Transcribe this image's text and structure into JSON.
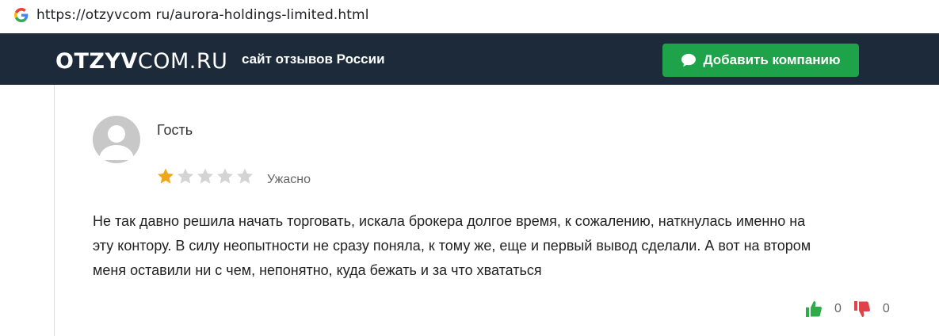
{
  "browser": {
    "url": "https://otzyvcom ru/aurora-holdings-limited.html"
  },
  "header": {
    "logo_bold": "OTZYV",
    "logo_light": "COM.RU",
    "tagline": "сайт отзывов России",
    "add_button_label": "Добавить компанию"
  },
  "review": {
    "author": "Гость",
    "rating": 1,
    "rating_max": 5,
    "rating_label": "Ужасно",
    "lines": [
      "Не так давно решила начать торговать, искала брокера долгое время, к сожалению, наткнулась именно на",
      "эту контору. В силу неопытности не сразу поняла, к тому же, еще и первый вывод сделали. А вот на втором",
      "меня оставили ни с чем, непонятно, куда бежать и за что хвататься"
    ],
    "likes": "0",
    "dislikes": "0"
  },
  "colors": {
    "header_bg": "#1c2a3a",
    "button_green": "#1fa34a",
    "star_filled": "#f0a81a",
    "star_empty": "#d4d4d4",
    "like_green": "#2eac4a",
    "dislike_red": "#e0424a"
  },
  "icons": [
    "google-icon",
    "chat-bubble-icon",
    "avatar-placeholder-icon",
    "star-icon",
    "thumbs-up-icon",
    "thumbs-down-icon"
  ]
}
